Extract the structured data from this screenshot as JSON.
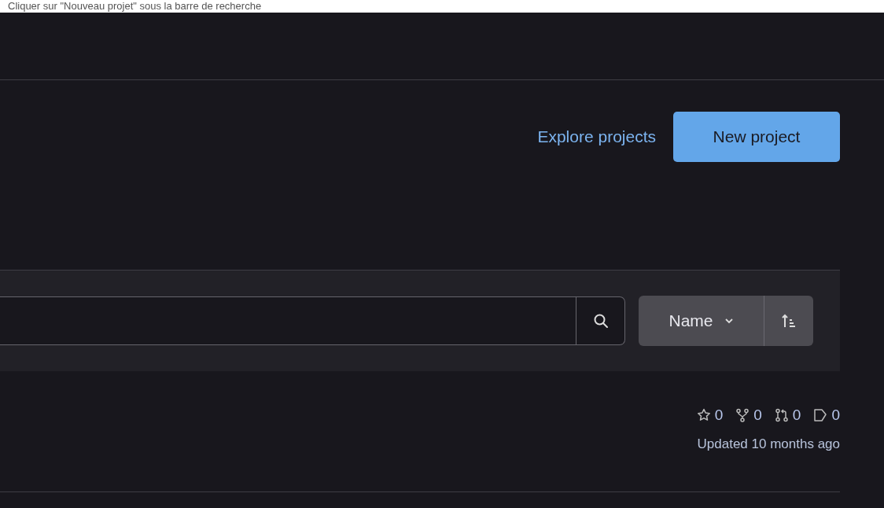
{
  "caption": "Cliquer sur \"Nouveau projet\" sous la barre de recherche",
  "actions": {
    "explore_link": "Explore projects",
    "new_button": "New project"
  },
  "filter": {
    "sort_label": "Name"
  },
  "project": {
    "stats": [
      {
        "kind": "star",
        "value": "0"
      },
      {
        "kind": "fork",
        "value": "0"
      },
      {
        "kind": "merge",
        "value": "0"
      },
      {
        "kind": "issue",
        "value": "0"
      }
    ],
    "updated": "Updated 10 months ago"
  }
}
